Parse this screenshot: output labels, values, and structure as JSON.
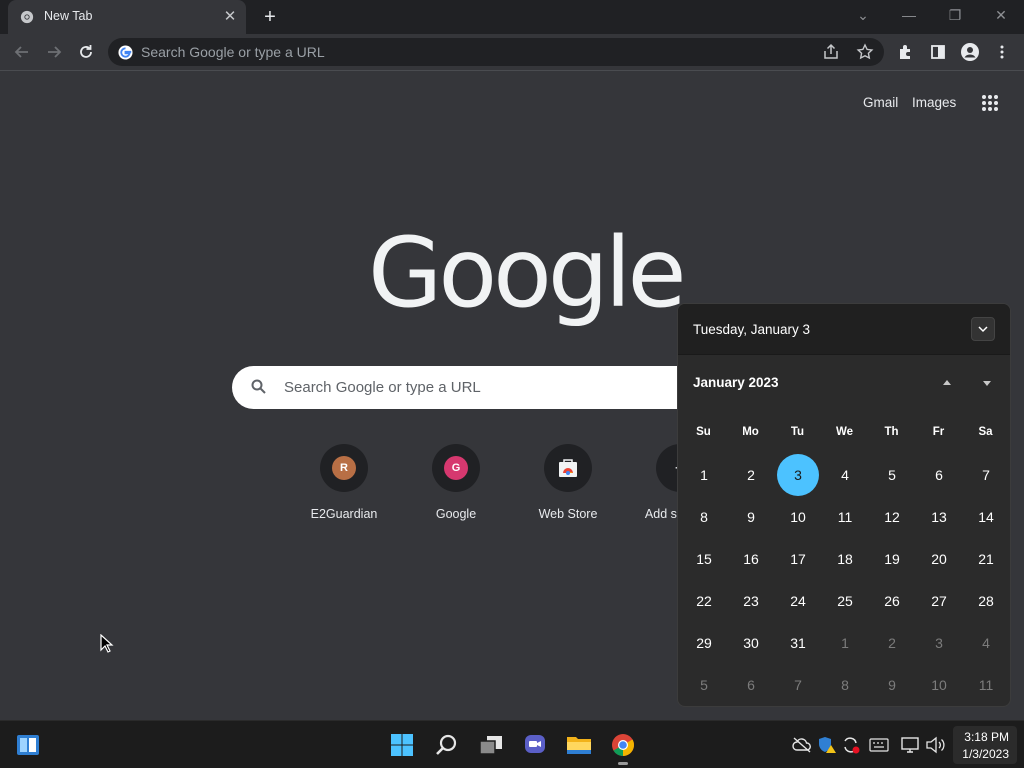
{
  "browser": {
    "tab": {
      "title": "New Tab",
      "close": "✕"
    },
    "new_tab": "+",
    "window": {
      "chevron": "⌄",
      "minimize": "—",
      "restore": "❐",
      "close": "✕"
    },
    "omnibox": {
      "placeholder": "Search Google or type a URL"
    }
  },
  "ntp": {
    "links": {
      "gmail": "Gmail",
      "images": "Images"
    },
    "logo": "Google",
    "search": {
      "placeholder": "Search Google or type a URL"
    },
    "shortcuts": [
      {
        "label": "E2Guardian",
        "letter": "R",
        "color": "#b86f45"
      },
      {
        "label": "Google",
        "letter": "G",
        "color": "#d6386f"
      },
      {
        "label": "Web Store",
        "letter": "",
        "color": ""
      },
      {
        "label": "Add shortcut",
        "letter": "+",
        "color": ""
      }
    ]
  },
  "calendar": {
    "header_date": "Tuesday, January 3",
    "month_label": "January 2023",
    "weekdays": [
      "Su",
      "Mo",
      "Tu",
      "We",
      "Th",
      "Fr",
      "Sa"
    ],
    "weeks": [
      [
        "1",
        "2",
        "3",
        "4",
        "5",
        "6",
        "7"
      ],
      [
        "8",
        "9",
        "10",
        "11",
        "12",
        "13",
        "14"
      ],
      [
        "15",
        "16",
        "17",
        "18",
        "19",
        "20",
        "21"
      ],
      [
        "22",
        "23",
        "24",
        "25",
        "26",
        "27",
        "28"
      ],
      [
        "29",
        "30",
        "31",
        "1",
        "2",
        "3",
        "4"
      ],
      [
        "5",
        "6",
        "7",
        "8",
        "9",
        "10",
        "11"
      ]
    ],
    "today": "3",
    "accent": "#4cc2ff"
  },
  "taskbar": {
    "icons": [
      "widgets-icon",
      "start-icon",
      "search-icon",
      "task-view-icon",
      "chat-icon",
      "file-explorer-icon",
      "chrome-icon"
    ],
    "time": "3:18 PM",
    "date": "1/3/2023"
  }
}
